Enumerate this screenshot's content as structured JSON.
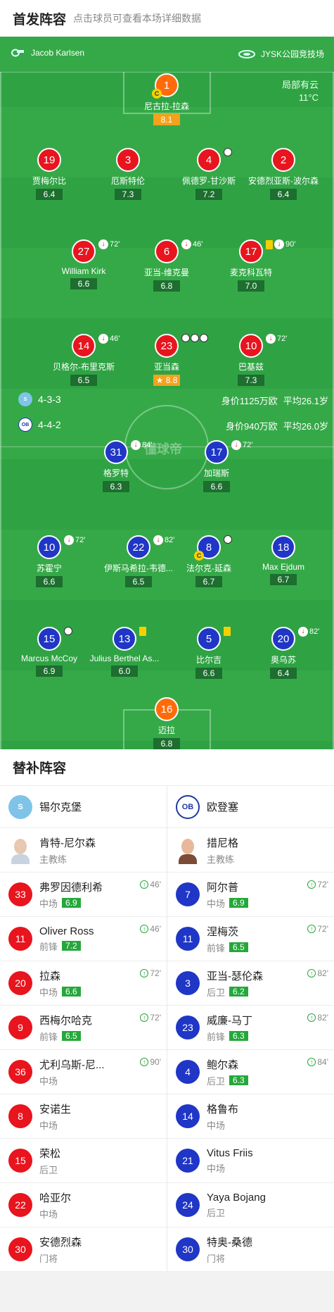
{
  "header": {
    "title": "首发阵容",
    "subtitle": "点击球员可查看本场详细数据"
  },
  "pitch": {
    "referee": "Jacob Karlsen",
    "venue": "JYSK公园竞技场",
    "weather": "局部有云",
    "temp": "11°C",
    "home": {
      "formation": "4-3-3",
      "value": "身价1125万欧",
      "age": "平均26.1岁"
    },
    "away": {
      "formation": "4-4-2",
      "value": "身价940万欧",
      "age": "平均26.0岁"
    },
    "watermark": "懂球帝"
  },
  "home_players": [
    {
      "num": "1",
      "name": "尼古拉-拉森",
      "rating": "8.1",
      "color": "org",
      "gold": true,
      "captain": true
    },
    {
      "num": "19",
      "name": "贾梅尔比",
      "rating": "6.4",
      "color": "red"
    },
    {
      "num": "3",
      "name": "厄斯特伦",
      "rating": "7.3",
      "color": "red"
    },
    {
      "num": "4",
      "name": "佩德罗-甘沙斯",
      "rating": "7.2",
      "color": "red"
    },
    {
      "num": "2",
      "name": "安德烈亚斯-波尔森",
      "rating": "6.4",
      "color": "red"
    },
    {
      "num": "27",
      "name": "William Kirk",
      "rating": "6.6",
      "color": "red",
      "sub": "72'"
    },
    {
      "num": "6",
      "name": "亚当-维克曼",
      "rating": "6.8",
      "color": "red",
      "sub": "46'"
    },
    {
      "num": "17",
      "name": "麦克科瓦特",
      "rating": "7.0",
      "color": "red",
      "sub": "90'"
    },
    {
      "num": "14",
      "name": "贝格尔-布里克斯",
      "rating": "6.5",
      "color": "red",
      "sub": "46'"
    },
    {
      "num": "23",
      "name": "亚当森",
      "rating": "8.8",
      "color": "red",
      "gold": true
    },
    {
      "num": "10",
      "name": "巴基兹",
      "rating": "7.3",
      "color": "red",
      "sub": "72'"
    }
  ],
  "away_players": [
    {
      "num": "31",
      "name": "格罗特",
      "rating": "6.3",
      "color": "blue",
      "sub": "84'"
    },
    {
      "num": "17",
      "name": "加瑞斯",
      "rating": "6.6",
      "color": "blue",
      "sub": "72'"
    },
    {
      "num": "10",
      "name": "苏霍宁",
      "rating": "6.6",
      "color": "blue",
      "sub": "72'"
    },
    {
      "num": "22",
      "name": "伊斯马希拉-韦德...",
      "rating": "6.5",
      "color": "blue",
      "sub": "82'"
    },
    {
      "num": "8",
      "name": "法尔克-延森",
      "rating": "6.7",
      "color": "blue",
      "captain": true
    },
    {
      "num": "18",
      "name": "Max Ejdum",
      "rating": "6.7",
      "color": "blue"
    },
    {
      "num": "15",
      "name": "Marcus McCoy",
      "rating": "6.9",
      "color": "blue"
    },
    {
      "num": "13",
      "name": "Julius Berthel As...",
      "rating": "6.0",
      "color": "blue"
    },
    {
      "num": "5",
      "name": "比尔吉",
      "rating": "6.6",
      "color": "blue"
    },
    {
      "num": "20",
      "name": "奥乌苏",
      "rating": "6.4",
      "color": "blue",
      "sub": "82'"
    },
    {
      "num": "16",
      "name": "迈拉",
      "rating": "6.8",
      "color": "org"
    }
  ],
  "subs": {
    "title": "替补阵容",
    "home": {
      "team": "锡尔克堡",
      "coach": "肯特-尼尔森",
      "coach_role": "主教练",
      "players": [
        {
          "num": "33",
          "name": "弗罗因德利希",
          "pos": "中场",
          "rating": "6.9",
          "time": "46'"
        },
        {
          "num": "11",
          "name": "Oliver Ross",
          "pos": "前锋",
          "rating": "7.2",
          "time": "46'"
        },
        {
          "num": "20",
          "name": "拉森",
          "pos": "中场",
          "rating": "6.6",
          "time": "72'"
        },
        {
          "num": "9",
          "name": "西梅尔哈克",
          "pos": "前锋",
          "rating": "6.5",
          "time": "72'"
        },
        {
          "num": "36",
          "name": "尤利乌斯-尼...",
          "pos": "中场",
          "rating": "",
          "time": "90'"
        },
        {
          "num": "8",
          "name": "安诺生",
          "pos": "中场",
          "rating": "",
          "time": ""
        },
        {
          "num": "15",
          "name": "荣松",
          "pos": "后卫",
          "rating": "",
          "time": ""
        },
        {
          "num": "22",
          "name": "哈亚尔",
          "pos": "中场",
          "rating": "",
          "time": ""
        },
        {
          "num": "30",
          "name": "安德烈森",
          "pos": "门将",
          "rating": "",
          "time": ""
        }
      ]
    },
    "away": {
      "team": "欧登塞",
      "coach": "措尼格",
      "coach_role": "主教练",
      "players": [
        {
          "num": "7",
          "name": "阿尔普",
          "pos": "中场",
          "rating": "6.9",
          "time": "72'"
        },
        {
          "num": "11",
          "name": "涅梅茨",
          "pos": "前锋",
          "rating": "6.5",
          "time": "72'"
        },
        {
          "num": "3",
          "name": "亚当-瑟伦森",
          "pos": "后卫",
          "rating": "6.2",
          "time": "82'"
        },
        {
          "num": "23",
          "name": "威廉-马丁",
          "pos": "前锋",
          "rating": "6.3",
          "time": "82'"
        },
        {
          "num": "4",
          "name": "鲍尔森",
          "pos": "后卫",
          "rating": "6.3",
          "time": "84'"
        },
        {
          "num": "14",
          "name": "格鲁布",
          "pos": "中场",
          "rating": "",
          "time": ""
        },
        {
          "num": "21",
          "name": "Vitus Friis",
          "pos": "中场",
          "rating": "",
          "time": ""
        },
        {
          "num": "24",
          "name": "Yaya Bojang",
          "pos": "后卫",
          "rating": "",
          "time": ""
        },
        {
          "num": "30",
          "name": "特奥-桑德",
          "pos": "门将",
          "rating": "",
          "time": ""
        }
      ]
    }
  }
}
